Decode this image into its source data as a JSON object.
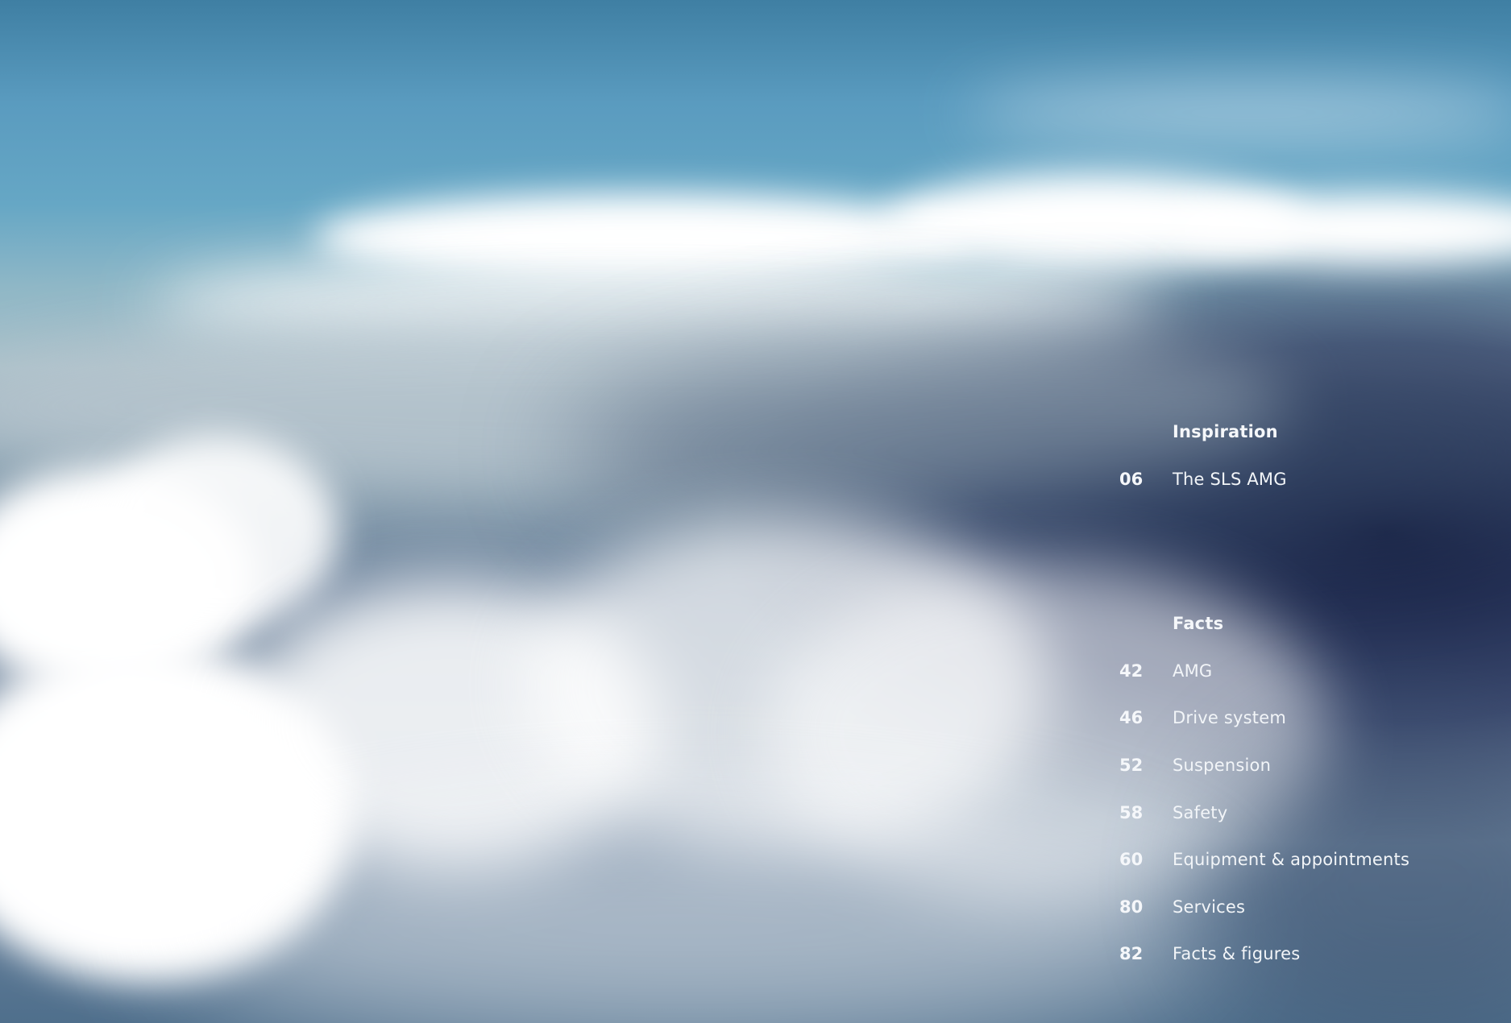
{
  "background": {
    "kind": "photo-clouds",
    "colors": {
      "sky_top": "#3f7fa3",
      "sky_mid": "#66a7c5",
      "cloud_white": "#ffffff",
      "storm_navy": "#0e163a"
    }
  },
  "contents": {
    "sections": [
      {
        "heading": "Inspiration",
        "items": [
          {
            "page": "06",
            "label": "The SLS AMG"
          }
        ]
      },
      {
        "heading": "Facts",
        "items": [
          {
            "page": "42",
            "label": "AMG"
          },
          {
            "page": "46",
            "label": "Drive system"
          },
          {
            "page": "52",
            "label": "Suspension"
          },
          {
            "page": "58",
            "label": "Safety"
          },
          {
            "page": "60",
            "label": "Equipment & appointments"
          },
          {
            "page": "80",
            "label": "Services"
          },
          {
            "page": "82",
            "label": "Facts & figures"
          }
        ]
      }
    ]
  }
}
